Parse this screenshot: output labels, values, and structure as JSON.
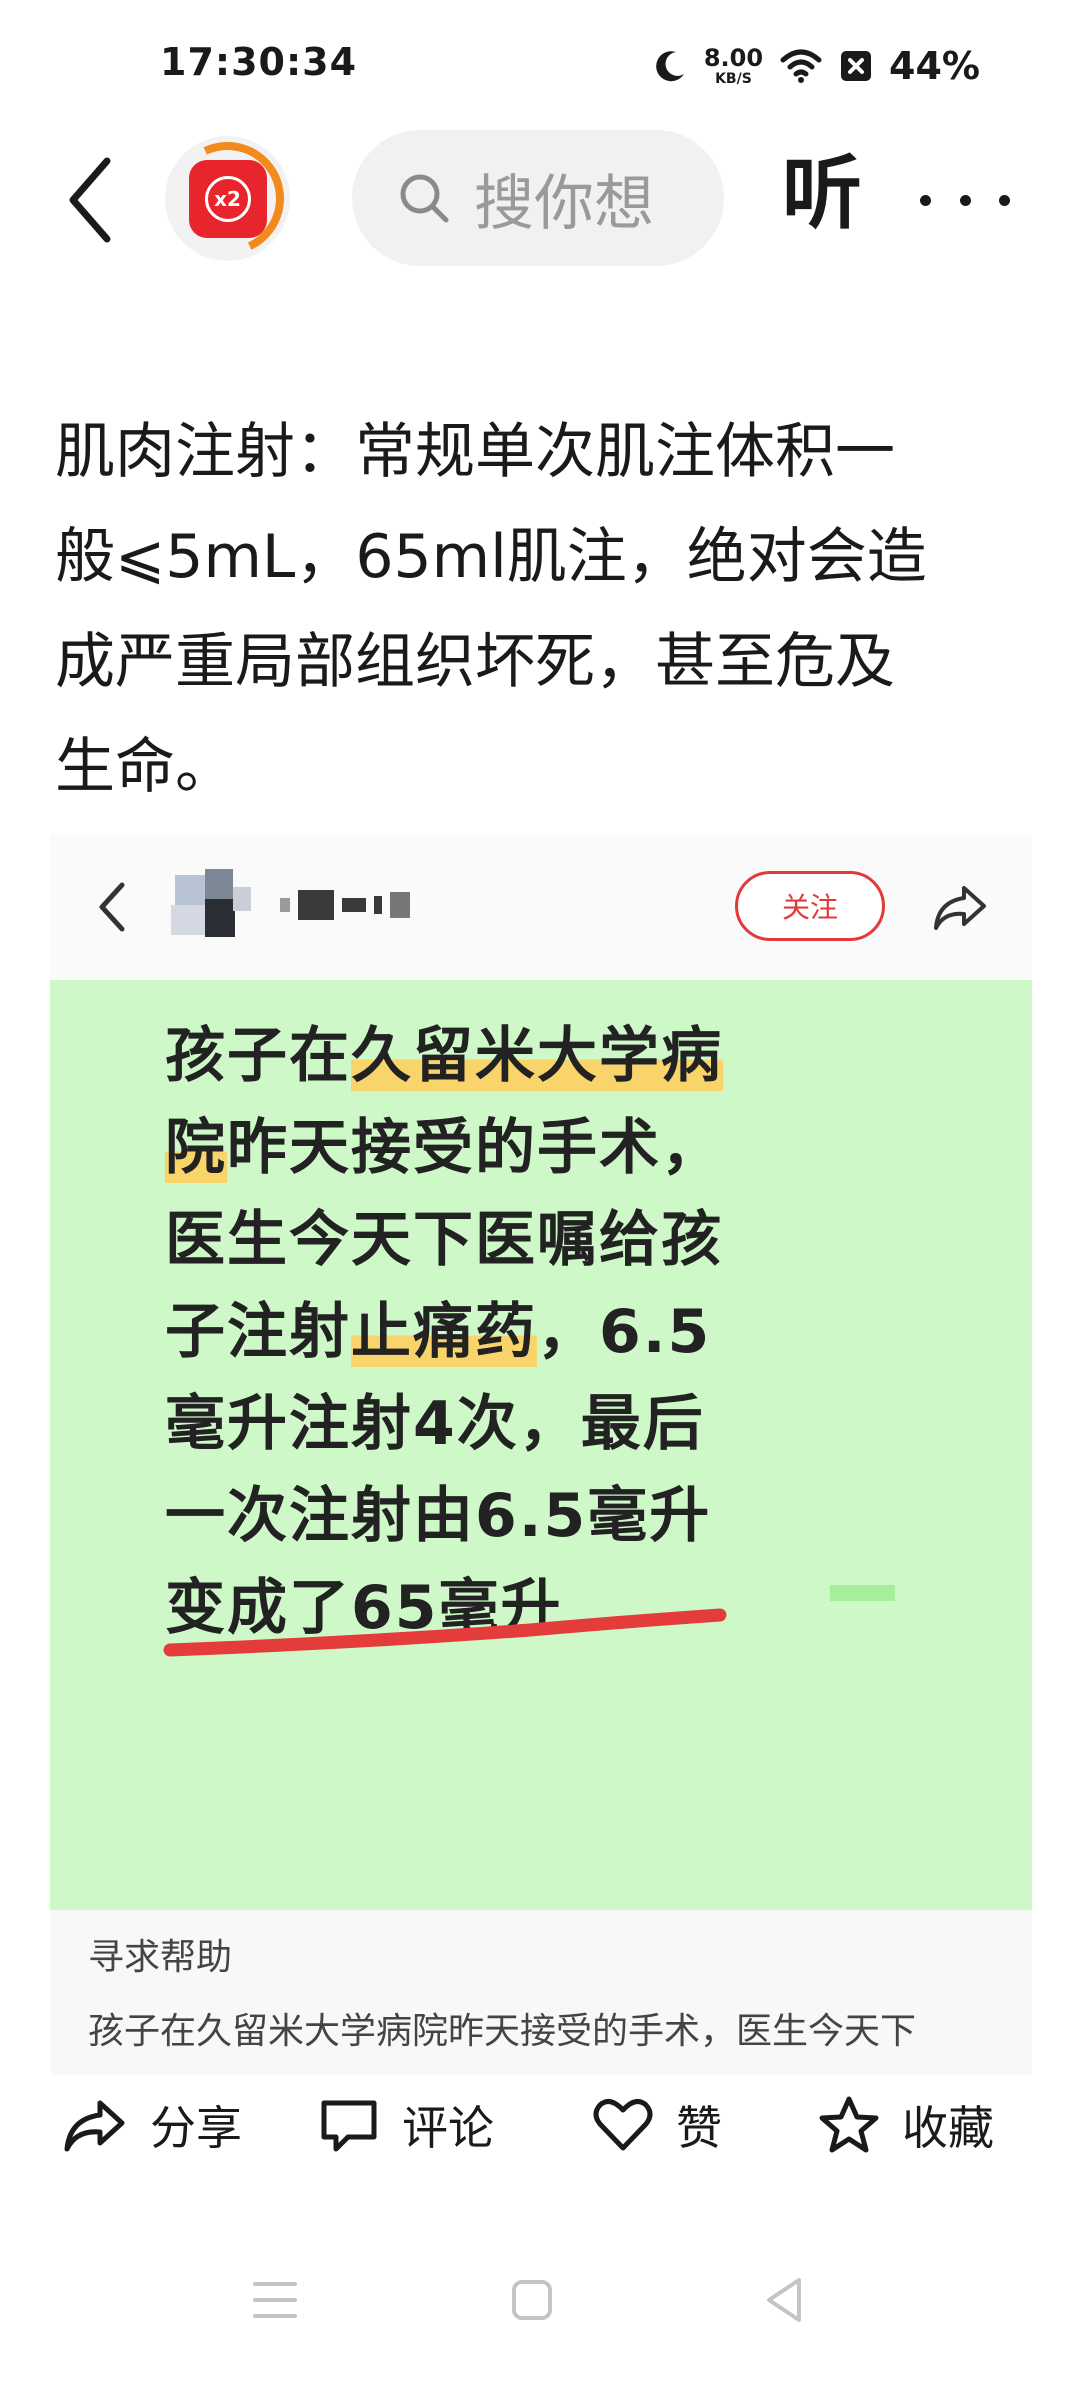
{
  "status_bar": {
    "time": "17:30:34",
    "net_speed_value": "8.00",
    "net_speed_unit": "KB/S",
    "battery": "44%"
  },
  "top_nav": {
    "badge_text": "x2",
    "search_placeholder": "搜你想",
    "listen_label": "听"
  },
  "article": {
    "lines": [
      "肌肉注射：常规单次肌注体积一",
      "般⩽5mL，65ml肌注，绝对会造",
      "成严重局部组织坏死，甚至危及",
      "生命。"
    ]
  },
  "embed": {
    "follow_label": "关注",
    "post_lines": {
      "l1a": "孩子在",
      "l1b": "久留米大学病",
      "l2a": "院",
      "l2b": "昨天接受的手术，",
      "l3": "医生今天下医嘱给孩",
      "l4a": "子注射",
      "l4b": "止痛药",
      "l4c": "，6.5",
      "l5": "毫升注射4次，最后",
      "l6": "一次注射由6.5毫升",
      "l7": "变成了65毫升"
    },
    "footer_title": "寻求帮助",
    "footer_text": "孩子在久留米大学病院昨天接受的手术，医生今天下"
  },
  "actions": {
    "share": "分享",
    "comment": "评论",
    "like": "赞",
    "favorite": "收藏"
  },
  "colors": {
    "accent_red": "#e23a3a",
    "highlight": "#f9d46a",
    "post_bg": "#cff8c9"
  }
}
